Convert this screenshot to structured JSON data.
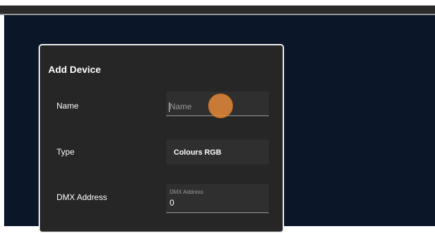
{
  "dialog": {
    "title": "Add Device",
    "fields": {
      "name": {
        "label": "Name",
        "placeholder": "Name",
        "value": ""
      },
      "type": {
        "label": "Type",
        "value": "Colours RGB"
      },
      "dmx": {
        "label": "DMX Address",
        "floating_label": "DMX Address",
        "value": "0"
      }
    }
  }
}
